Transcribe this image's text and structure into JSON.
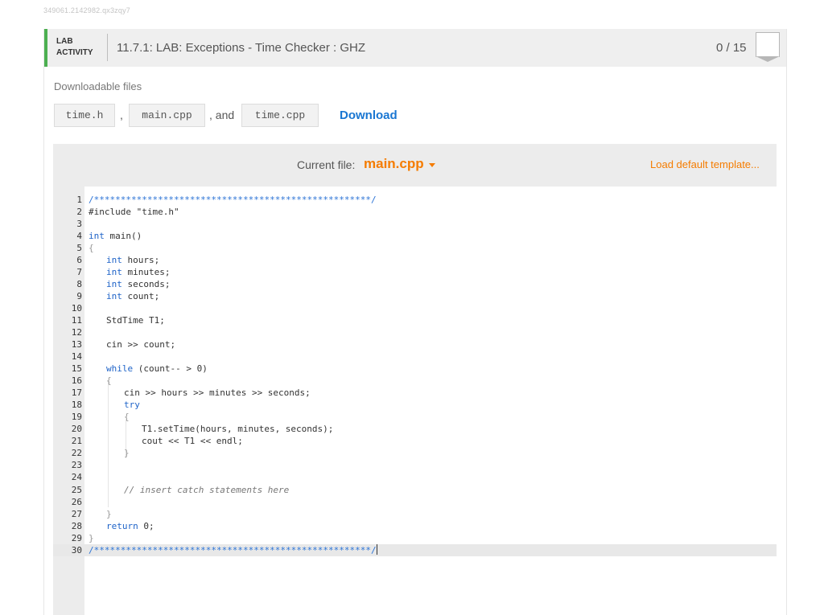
{
  "session_id": "349061.2142982.qx3zqy7",
  "header": {
    "lab_label_line1": "LAB",
    "lab_label_line2": "ACTIVITY",
    "title": "11.7.1: LAB: Exceptions - Time Checker : GHZ",
    "score": "0 / 15"
  },
  "downloads": {
    "label": "Downloadable files",
    "files": [
      "time.h",
      "main.cpp",
      "time.cpp"
    ],
    "sep1": ",",
    "sep2": ", and",
    "download_label": "Download"
  },
  "editor": {
    "current_file_label": "Current file:",
    "current_file": "main.cpp",
    "load_default": "Load default template...",
    "line_numbers": [
      "1",
      "2",
      "3",
      "4",
      "5",
      "6",
      "7",
      "8",
      "9",
      "10",
      "11",
      "12",
      "13",
      "14",
      "15",
      "16",
      "17",
      "18",
      "19",
      "20",
      "21",
      "22",
      "23",
      "24",
      "25",
      "26",
      "27",
      "28",
      "29",
      "30"
    ],
    "code": {
      "l1": "/****************************************************/",
      "l2_include": "#include ",
      "l2_file": "\"time.h\"",
      "l4_type": "int",
      "l4_rest": " main()",
      "l5": "{",
      "l6_type": "int",
      "l6_rest": " hours;",
      "l7_type": "int",
      "l7_rest": " minutes;",
      "l8_type": "int",
      "l8_rest": " seconds;",
      "l9_type": "int",
      "l9_rest": " count;",
      "l11": "StdTime T1;",
      "l13": "cin >> count;",
      "l15_kw": "while",
      "l15_rest": " (count-- > 0)",
      "l16": "{",
      "l17": "cin >> hours >> minutes >> seconds;",
      "l18": "try",
      "l19": "{",
      "l20": "T1.setTime(hours, minutes, seconds);",
      "l21": "cout << T1 << endl;",
      "l22": "}",
      "l25": "// insert catch statements here",
      "l27": "}",
      "l28_kw": "return",
      "l28_rest": " 0;",
      "l29": "}",
      "l30": "/****************************************************/"
    }
  },
  "colors": {
    "accent_green": "#4caf50",
    "accent_orange": "#f57c00",
    "link_blue": "#1976d2",
    "keyword_blue": "#1e63c8"
  }
}
